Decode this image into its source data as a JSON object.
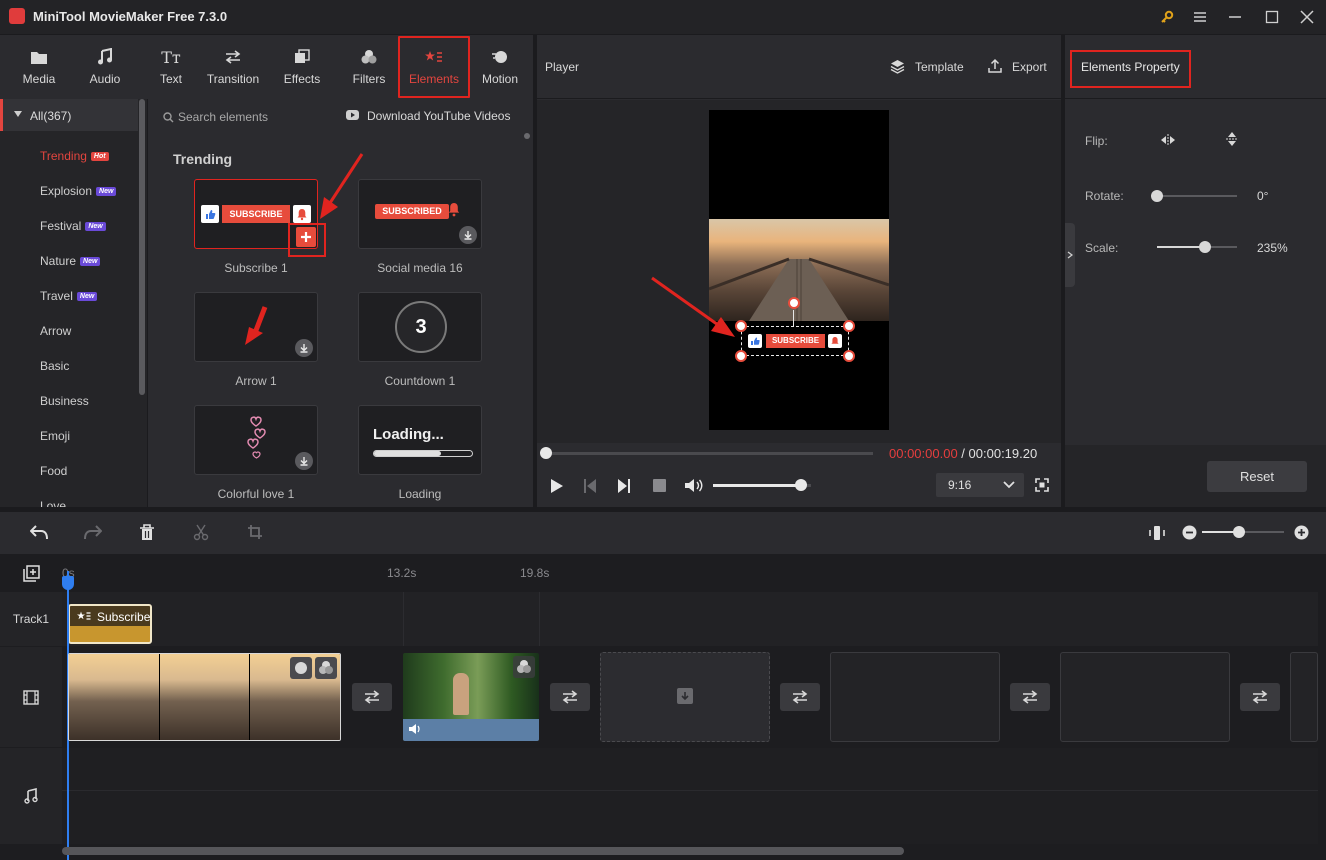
{
  "app": {
    "title": "MiniTool MovieMaker Free 7.3.0"
  },
  "toolbar": {
    "tabs": [
      {
        "label": "Media",
        "icon": "folder-icon"
      },
      {
        "label": "Audio",
        "icon": "music-note-icon"
      },
      {
        "label": "Text",
        "icon": "text-icon"
      },
      {
        "label": "Transition",
        "icon": "transition-icon"
      },
      {
        "label": "Effects",
        "icon": "effects-icon"
      },
      {
        "label": "Filters",
        "icon": "filters-icon"
      },
      {
        "label": "Elements",
        "icon": "elements-icon",
        "active": true
      },
      {
        "label": "Motion",
        "icon": "motion-icon"
      }
    ]
  },
  "categories": {
    "all_label": "All(367)",
    "items": [
      {
        "label": "Trending",
        "tag": "Hot"
      },
      {
        "label": "Explosion",
        "tag": "New"
      },
      {
        "label": "Festival",
        "tag": "New"
      },
      {
        "label": "Nature",
        "tag": "New"
      },
      {
        "label": "Travel",
        "tag": "New"
      },
      {
        "label": "Arrow"
      },
      {
        "label": "Basic"
      },
      {
        "label": "Business"
      },
      {
        "label": "Emoji"
      },
      {
        "label": "Food"
      },
      {
        "label": "Love"
      }
    ]
  },
  "search": {
    "placeholder": "Search elements",
    "download_link": "Download YouTube Videos"
  },
  "elements": {
    "section_title": "Trending",
    "items": [
      {
        "label": "Subscribe 1",
        "art_text": "SUBSCRIBE"
      },
      {
        "label": "Social media 16",
        "art_text": "SUBSCRIBED"
      },
      {
        "label": "Arrow 1"
      },
      {
        "label": "Countdown 1",
        "art_text": "3"
      },
      {
        "label": "Colorful love 1"
      },
      {
        "label": "Loading",
        "art_text": "Loading..."
      }
    ]
  },
  "player": {
    "title": "Player",
    "template_label": "Template",
    "export_label": "Export",
    "overlay_text": "SUBSCRIBE",
    "current_time": "00:00:00.00",
    "separator": " / ",
    "total_time": "00:00:19.20",
    "aspect_ratio": "9:16",
    "volume_level": 0.9,
    "progress": 0.0
  },
  "properties": {
    "title": "Elements Property",
    "flip_label": "Flip:",
    "rotate_label": "Rotate:",
    "rotate_value": "0°",
    "rotate_level": 0.0,
    "scale_label": "Scale:",
    "scale_value": "235%",
    "scale_level": 0.6,
    "reset_label": "Reset"
  },
  "timeline": {
    "ruler": [
      "0s",
      "13.2s",
      "19.8s"
    ],
    "track1_label": "Track1",
    "element_clip_label": "Subscribe",
    "zoom_level": 0.45
  },
  "colors": {
    "accent": "#e0241f",
    "brand_red": "#e74c3c",
    "playhead": "#2f7ef0",
    "clip_gold": "#c8962e"
  }
}
